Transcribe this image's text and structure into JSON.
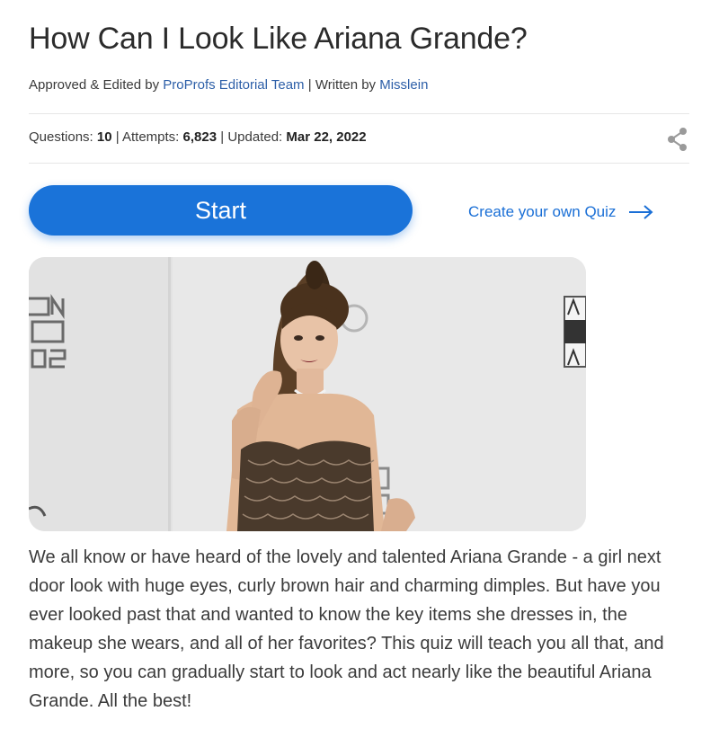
{
  "quiz": {
    "title": "How Can I Look Like Ariana Grande?"
  },
  "byline": {
    "approved_prefix": "Approved & Edited by",
    "editor": "ProProfs Editorial Team",
    "separator": "|",
    "written_prefix": "Written by",
    "author": "Misslein"
  },
  "stats": {
    "questions_label": "Questions:",
    "questions_value": "10",
    "attempts_label": "Attempts:",
    "attempts_value": "6,823",
    "updated_label": "Updated:",
    "updated_value": "Mar 22, 2022",
    "separator": "|"
  },
  "actions": {
    "start_label": "Start",
    "create_label": "Create your own Quiz"
  },
  "description": "We all know or have heard of the lovely and talented Ariana Grande - a girl next door look with huge eyes, curly brown hair and charming dimples. But have you ever looked past that and wanted to know the key items she dresses in, the makeup she wears, and all of her favorites? This quiz will teach you all that, and more, so you can gradually start to look and act nearly like the beautiful Ariana Grande. All the best!",
  "icons": {
    "share": "share-icon",
    "arrow": "arrow-right-icon"
  },
  "colors": {
    "primary": "#1a73d9",
    "link": "#2d5fa8",
    "text": "#333333"
  }
}
